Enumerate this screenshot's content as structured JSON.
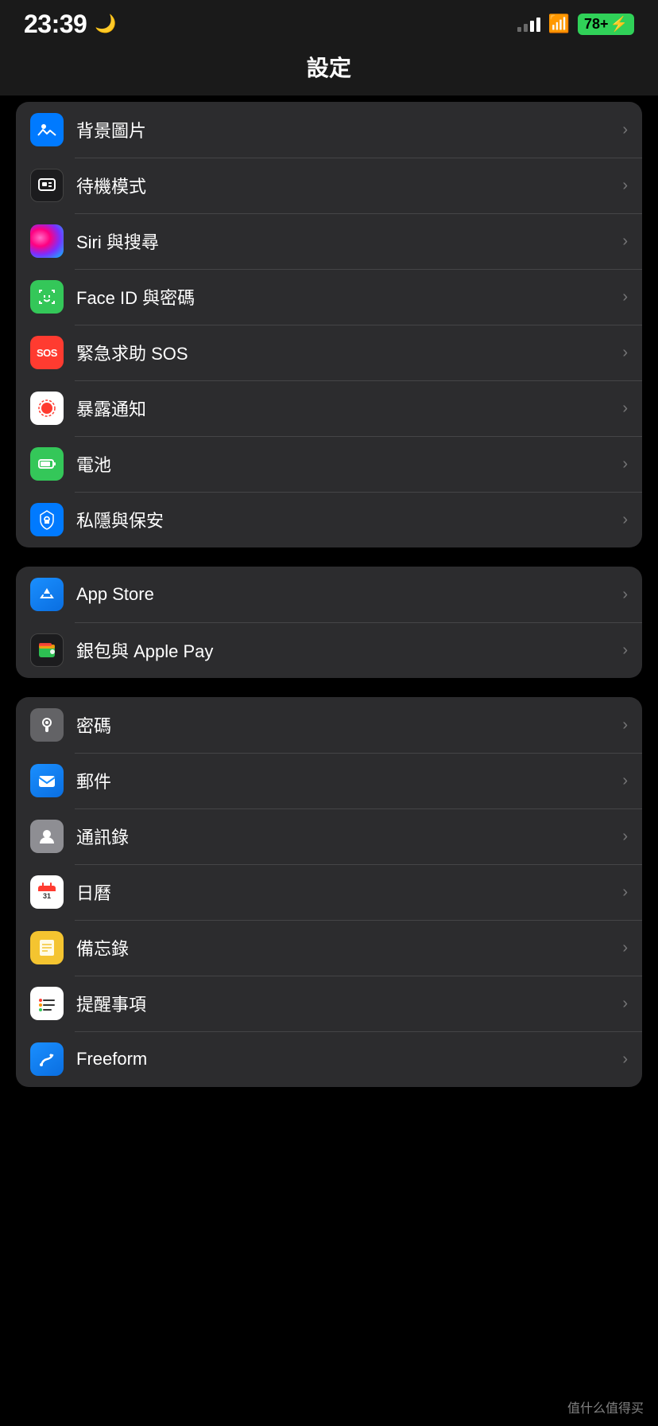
{
  "statusBar": {
    "time": "23:39",
    "moonIcon": "🌙",
    "battery": "78+",
    "batterySymbol": "⚡"
  },
  "pageTitle": "設定",
  "section1": {
    "items": [
      {
        "id": "wallpaper",
        "label": "背景圖片",
        "iconType": "blue",
        "iconEmoji": "🌸"
      },
      {
        "id": "standby",
        "label": "待機模式",
        "iconType": "black",
        "iconEmoji": "⊡"
      },
      {
        "id": "siri",
        "label": "Siri 與搜尋",
        "iconType": "siri",
        "iconEmoji": ""
      },
      {
        "id": "faceid",
        "label": "Face ID 與密碼",
        "iconType": "green",
        "iconEmoji": "🪪"
      },
      {
        "id": "sos",
        "label": "緊急求助 SOS",
        "iconType": "red",
        "iconText": "SOS"
      },
      {
        "id": "exposure",
        "label": "暴露通知",
        "iconType": "white",
        "iconEmoji": "🔴"
      },
      {
        "id": "battery",
        "label": "電池",
        "iconType": "battery-green",
        "iconEmoji": "🔋"
      },
      {
        "id": "privacy",
        "label": "私隱與保安",
        "iconType": "blue-hand",
        "iconEmoji": "✋"
      }
    ]
  },
  "section2": {
    "items": [
      {
        "id": "appstore",
        "label": "App Store",
        "iconType": "appstore",
        "iconEmoji": "A"
      },
      {
        "id": "wallet",
        "label": "銀包與 Apple Pay",
        "iconType": "wallet",
        "iconEmoji": "💳"
      }
    ]
  },
  "section3": {
    "items": [
      {
        "id": "passwords",
        "label": "密碼",
        "iconType": "key",
        "iconEmoji": "🔑"
      },
      {
        "id": "mail",
        "label": "郵件",
        "iconType": "mail",
        "iconEmoji": "✉️"
      },
      {
        "id": "contacts",
        "label": "通訊錄",
        "iconType": "contacts",
        "iconEmoji": "👤"
      },
      {
        "id": "calendar",
        "label": "日曆",
        "iconType": "calendar",
        "iconEmoji": "📅"
      },
      {
        "id": "notes",
        "label": "備忘錄",
        "iconType": "notes",
        "iconEmoji": "📝"
      },
      {
        "id": "reminders",
        "label": "提醒事項",
        "iconType": "reminders",
        "iconEmoji": "⏰"
      },
      {
        "id": "freeform",
        "label": "Freeform",
        "iconType": "freeform",
        "iconEmoji": "✏️"
      }
    ]
  },
  "watermark": "值什么值得买",
  "chevron": "›"
}
